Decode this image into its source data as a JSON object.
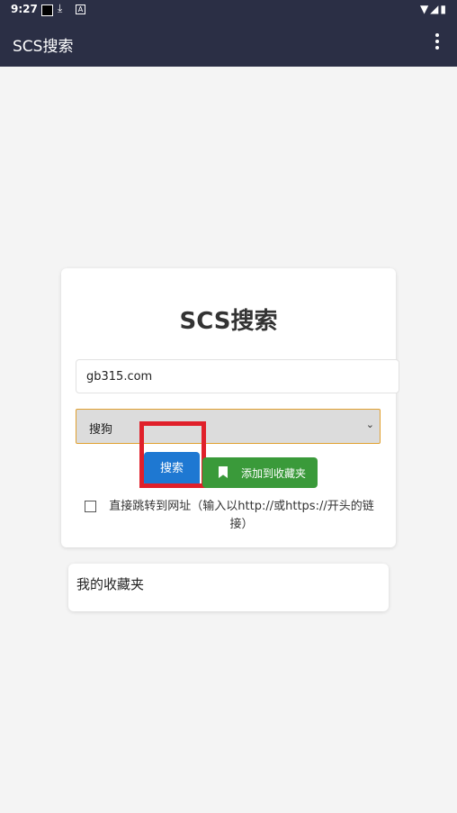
{
  "status_bar": {
    "time": "9:27",
    "download_glyph": "⤓",
    "a_glyph": "A",
    "right_glyphs": "▼◢▮"
  },
  "app_bar": {
    "title": "SCS搜索",
    "menu_icon": "more-vert-icon"
  },
  "search_card": {
    "heading": "SCS搜索",
    "query_value": "gb315.com",
    "engine_selected": "搜狗",
    "search_button": "搜索",
    "add_favorite_button": "添加到收藏夹",
    "direct_jump_label": "直接跳转到网址（输入以http://或https://开头的链接）",
    "direct_jump_checked": false
  },
  "favorites": {
    "title": "我的收藏夹"
  },
  "colors": {
    "app_bar": "#2b2f45",
    "search_button": "#1e78d2",
    "favorite_button": "#3a9a3a",
    "highlight_box": "#e0202a"
  }
}
